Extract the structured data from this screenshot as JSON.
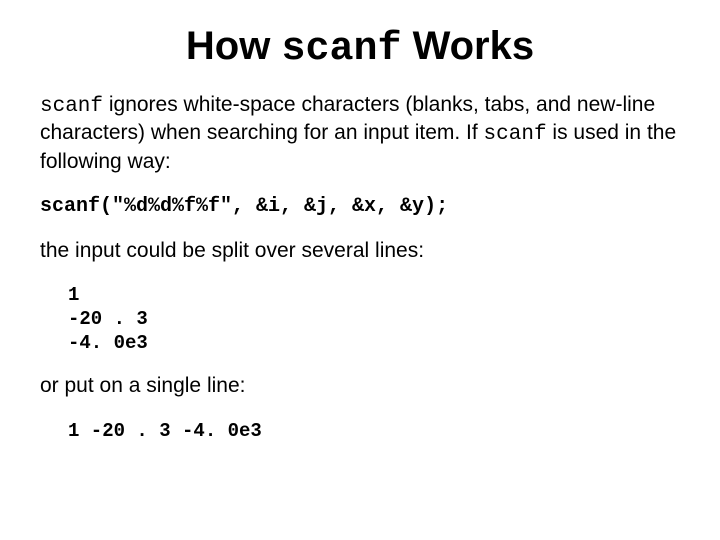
{
  "title": {
    "part1": "How ",
    "code": "scanf",
    "part2": " Works"
  },
  "para1": {
    "code1": "scanf",
    "text1": " ignores white-space characters (blanks, tabs, and new-line characters) when searching for an input item. If ",
    "code2": "scanf",
    "text2": " is used in the following way:"
  },
  "code_call": "scanf(\"%d%d%f%f\", &i, &j, &x, &y);",
  "para2": "the input could be split over several lines:",
  "input_multi": "1\n-20 . 3\n-4. 0e3",
  "para3": "or put on a single line:",
  "input_single": "1 -20 . 3 -4. 0e3"
}
